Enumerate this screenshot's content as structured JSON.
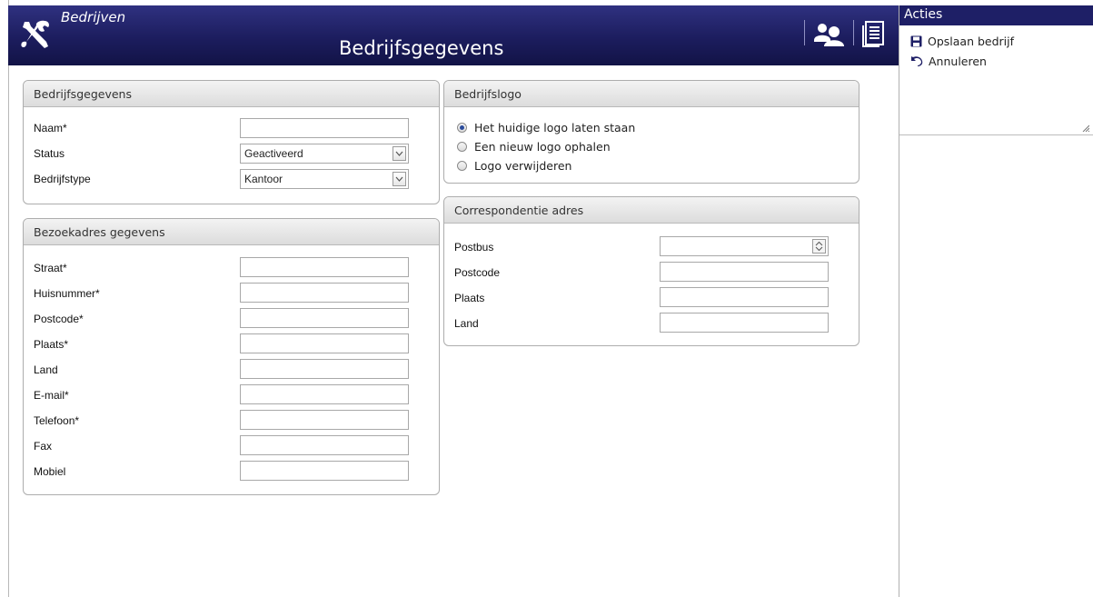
{
  "header": {
    "subtitle": "Bedrijven",
    "title": "Bedrijfsgegevens",
    "icons": [
      "tools-icon",
      "users-icon",
      "list-icon"
    ]
  },
  "sidebar": {
    "title": "Acties",
    "items": [
      {
        "label": "Opslaan bedrijf",
        "icon": "floppy-disk-icon"
      },
      {
        "label": "Annuleren",
        "icon": "undo-icon"
      }
    ]
  },
  "company": {
    "heading": "Bedrijfsgegevens",
    "name_label": "Naam*",
    "name_value": "",
    "status_label": "Status",
    "status_value": "Geactiveerd",
    "type_label": "Bedrijfstype",
    "type_value": "Kantoor"
  },
  "visit_address": {
    "heading": "Bezoekadres gegevens",
    "fields": [
      {
        "label": "Straat*",
        "value": ""
      },
      {
        "label": "Huisnummer*",
        "value": ""
      },
      {
        "label": "Postcode*",
        "value": ""
      },
      {
        "label": "Plaats*",
        "value": ""
      },
      {
        "label": "Land",
        "value": ""
      },
      {
        "label": "E-mail*",
        "value": ""
      },
      {
        "label": "Telefoon*",
        "value": ""
      },
      {
        "label": "Fax",
        "value": ""
      },
      {
        "label": "Mobiel",
        "value": ""
      }
    ]
  },
  "logo": {
    "heading": "Bedrijfslogo",
    "options": [
      {
        "label": "Het huidige logo laten staan",
        "checked": true
      },
      {
        "label": "Een nieuw logo ophalen",
        "checked": false
      },
      {
        "label": "Logo verwijderen",
        "checked": false
      }
    ]
  },
  "correspondence": {
    "heading": "Correspondentie adres",
    "fields": [
      {
        "label": "Postbus",
        "value": ""
      },
      {
        "label": "Postcode",
        "value": ""
      },
      {
        "label": "Plaats",
        "value": ""
      },
      {
        "label": "Land",
        "value": ""
      }
    ]
  },
  "colors": {
    "header_bg": "#1c1d5e",
    "accent": "#1e1f66",
    "panel_head": "#e6e6e6"
  }
}
